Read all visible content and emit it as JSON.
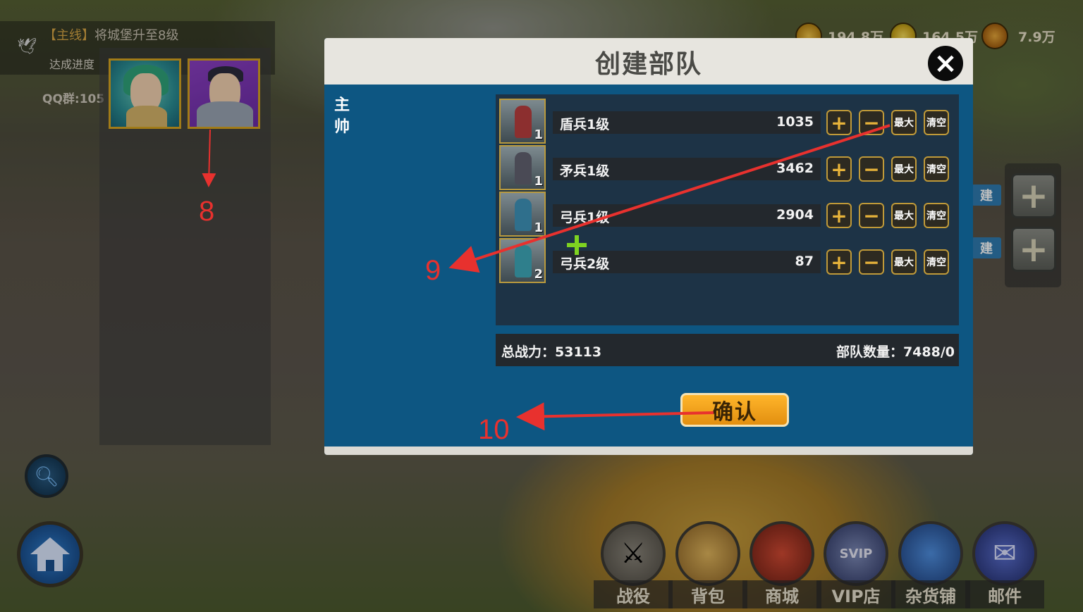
{
  "quest": {
    "tag": "【主线】",
    "title": "将城堡升至8级",
    "progress": "达成进度",
    "qq": "QQ群:105"
  },
  "resources": [
    {
      "icon": "gold-coin-icon",
      "value": "194.8万"
    },
    {
      "icon": "corn-icon",
      "value": "164.5万"
    },
    {
      "icon": "fire-coin-icon",
      "value": "7.9万"
    }
  ],
  "side": {
    "build_tab_1": "建",
    "build_tab_2": "建",
    "plus": "+"
  },
  "modal": {
    "title": "创建部队",
    "close": "×",
    "commander_label": "主帅",
    "troops": [
      {
        "name": "盾兵1级",
        "count": "1035",
        "level": "1",
        "color": "#8c2f2f"
      },
      {
        "name": "矛兵1级",
        "count": "3462",
        "level": "1",
        "color": "#4a4a55"
      },
      {
        "name": "弓兵1级",
        "count": "2904",
        "level": "1",
        "color": "#2f6f8c"
      },
      {
        "name": "弓兵2级",
        "count": "87",
        "level": "2",
        "color": "#2f7f8c"
      }
    ],
    "btn_plus": "+",
    "btn_minus": "−",
    "btn_max": "最大",
    "btn_clear": "清空",
    "total_power": "总战力：53113",
    "troop_count": "部队数量：7488/0",
    "confirm": "确认"
  },
  "menu": [
    {
      "label": "战役",
      "icon": "crossed-swords-icon",
      "color": "#6e6a62"
    },
    {
      "label": "背包",
      "icon": "backpack-icon",
      "color": "#c79b45"
    },
    {
      "label": "商城",
      "icon": "shop-pavilion-icon",
      "color": "#b53b2c"
    },
    {
      "label": "VIP店",
      "icon": "svip-crown-icon",
      "color": "#4a5ea8"
    },
    {
      "label": "杂货铺",
      "icon": "gift-box-icon",
      "color": "#3a76c9"
    },
    {
      "label": "邮件",
      "icon": "envelope-icon",
      "color": "#3c4f9e"
    }
  ],
  "annotations": {
    "n8": "8",
    "n9": "9",
    "n10": "10"
  }
}
